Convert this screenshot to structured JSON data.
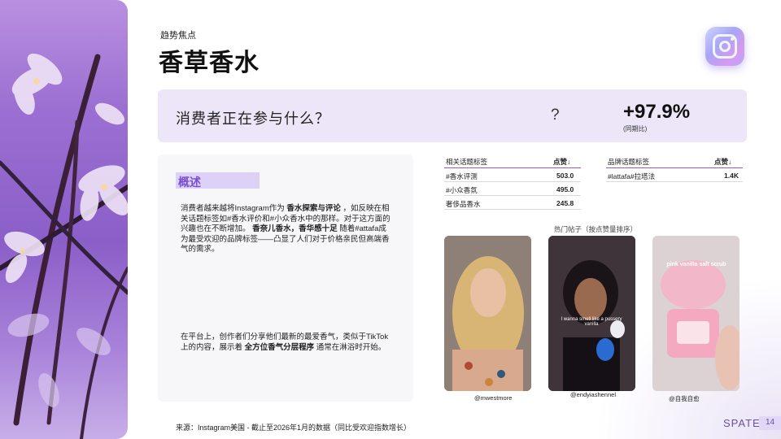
{
  "header": {
    "eyebrow": "趋势焦点",
    "title": "香草香水"
  },
  "question_bar": {
    "question": "消费者正在参与什么？",
    "question_mark": "?",
    "growth_value": "+97.9%",
    "growth_label": "(同期比)"
  },
  "overview": {
    "title": "概述",
    "p1_a": "消费者越来越将Instagram作为 ",
    "p1_b": "香水探索与评论",
    "p1_c": " ，如反映在相关话题标签如#香水评价和#小众香水中的那样。对于这方面的兴趣也在不断增加。 ",
    "p1_d": "香奈儿香水，香华感十足",
    "p1_e": " 随着#attafa成为最受欢迎的品牌标签——凸显了人们对于价格亲民但高端香气的需求。",
    "p2_a": "在平台上，创作者们分享他们最新的最爱香气，类似于TikTok上的内容，展示着 ",
    "p2_b": "全方位香气分层程序",
    "p2_c": " 通常在淋浴时开始。"
  },
  "topics_table": {
    "col_label": "相关话题标签",
    "col_value": "点赞↓",
    "rows": [
      {
        "tag": "#香水评测",
        "value": "503.0"
      },
      {
        "tag": "#小众香氛",
        "value": "495.0"
      },
      {
        "tag": "奢侈品香水",
        "value": "245.8"
      }
    ]
  },
  "brands_table": {
    "col_label": "品牌话题标签",
    "col_value": "点赞↓",
    "rows": [
      {
        "tag": "#lattafa#拉塔法",
        "value": "1.4K"
      }
    ]
  },
  "posts": {
    "caption": "热门帖子（按点赞量排序）",
    "items": [
      {
        "handle": "@mwestmore",
        "overlay": ""
      },
      {
        "handle": "@endyiashennel",
        "overlay": "I wanna smell like a pussery vanilla"
      },
      {
        "handle": "@自我自愈",
        "overlay": "pink vanilla salt scrub"
      }
    ]
  },
  "footer": {
    "source": "来源：Instagram美国 - 截止至2026年1月的数据（同比受欢迎指数增长）",
    "brand": "SPATE",
    "page": "14"
  },
  "icons": {
    "logo": "instagram-logo-icon"
  },
  "colors": {
    "accent": "#8a5fc8",
    "panel": "#ece6f8",
    "card": "#f7f6f8"
  }
}
